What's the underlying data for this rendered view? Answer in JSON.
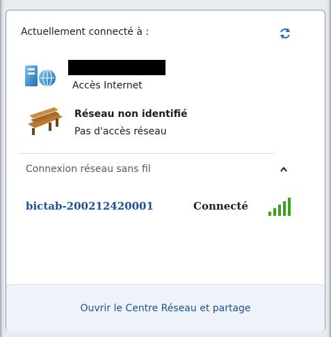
{
  "header": {
    "title": "Actuellement connecté à :"
  },
  "networks": [
    {
      "name": "",
      "status": "Accès Internet",
      "icon": "network-globe-icon"
    },
    {
      "name": "Réseau non identifié",
      "status": "Pas d'accès réseau",
      "icon": "bench-icon"
    }
  ],
  "wireless": {
    "section_label": "Connexion réseau sans fil",
    "items": [
      {
        "ssid": "bictab-200212420001",
        "status": "Connecté",
        "icon": "wifi-signal-icon"
      }
    ]
  },
  "footer": {
    "link_label": "Ouvrir le Centre Réseau et partage"
  },
  "colors": {
    "link": "#1f4f96",
    "footer_bg": "#eef3f9",
    "signal_green": "#3aa21a"
  }
}
